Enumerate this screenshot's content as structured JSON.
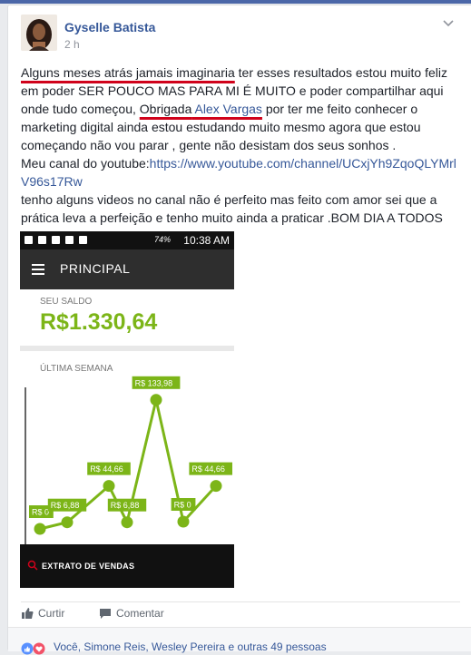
{
  "post": {
    "author": "Gyselle Batista",
    "time": "2 h",
    "text": {
      "l1_a": "Alguns meses atrás jamais imaginaria",
      "l1_b": " ter esses resultados estou muito feliz em poder SER POUCO MAS PARA MI É MUITO e poder compartilhar aqui onde tudo começou, ",
      "obrigada": "Obrigada",
      "space": " ",
      "mention": "Alex Vargas",
      "l1_c": " por ter me feito conhecer o marketing digital ainda estou estudando muito mesmo agora que estou começando não vou parar , gente não desistam dos seus sonhos .",
      "yt_prefix": "Meu canal do youtube:",
      "yt_link": "https://www.youtube.com/channel/UCxjYh9ZqoQLYMrlV96s17Rw",
      "l3": "tenho alguns videos no canal não é perfeito mas feito com amor sei que a prática leva a perfeição e tenho muito ainda a praticar .BOM DIA A TODOS"
    }
  },
  "screenshot": {
    "status_time": "10:38 AM",
    "battery": "74%",
    "app_title": "PRINCIPAL",
    "saldo_label": "SEU SALDO",
    "saldo_value": "R$1.330,64",
    "semana_label": "ÚLTIMA SEMANA",
    "extrato_label": "EXTRATO DE VENDAS"
  },
  "chart_data": {
    "type": "line",
    "values": [
      0,
      6.88,
      44.66,
      6.88,
      133.98,
      0,
      44.66
    ],
    "labels": [
      "R$ 0",
      "R$ 6,88",
      "R$ 44,66",
      "R$ 6,88",
      "R$ 133,98",
      "R$ 0",
      "R$ 44,66"
    ],
    "color": "#7cb518"
  },
  "actions": {
    "like": "Curtir",
    "comment": "Comentar"
  },
  "reactions": {
    "text": "Você, Simone Reis, Wesley Pereira e outras 49 pessoas"
  },
  "colors": {
    "link": "#365899",
    "accent": "#7cb518",
    "underline": "#d0021b"
  }
}
